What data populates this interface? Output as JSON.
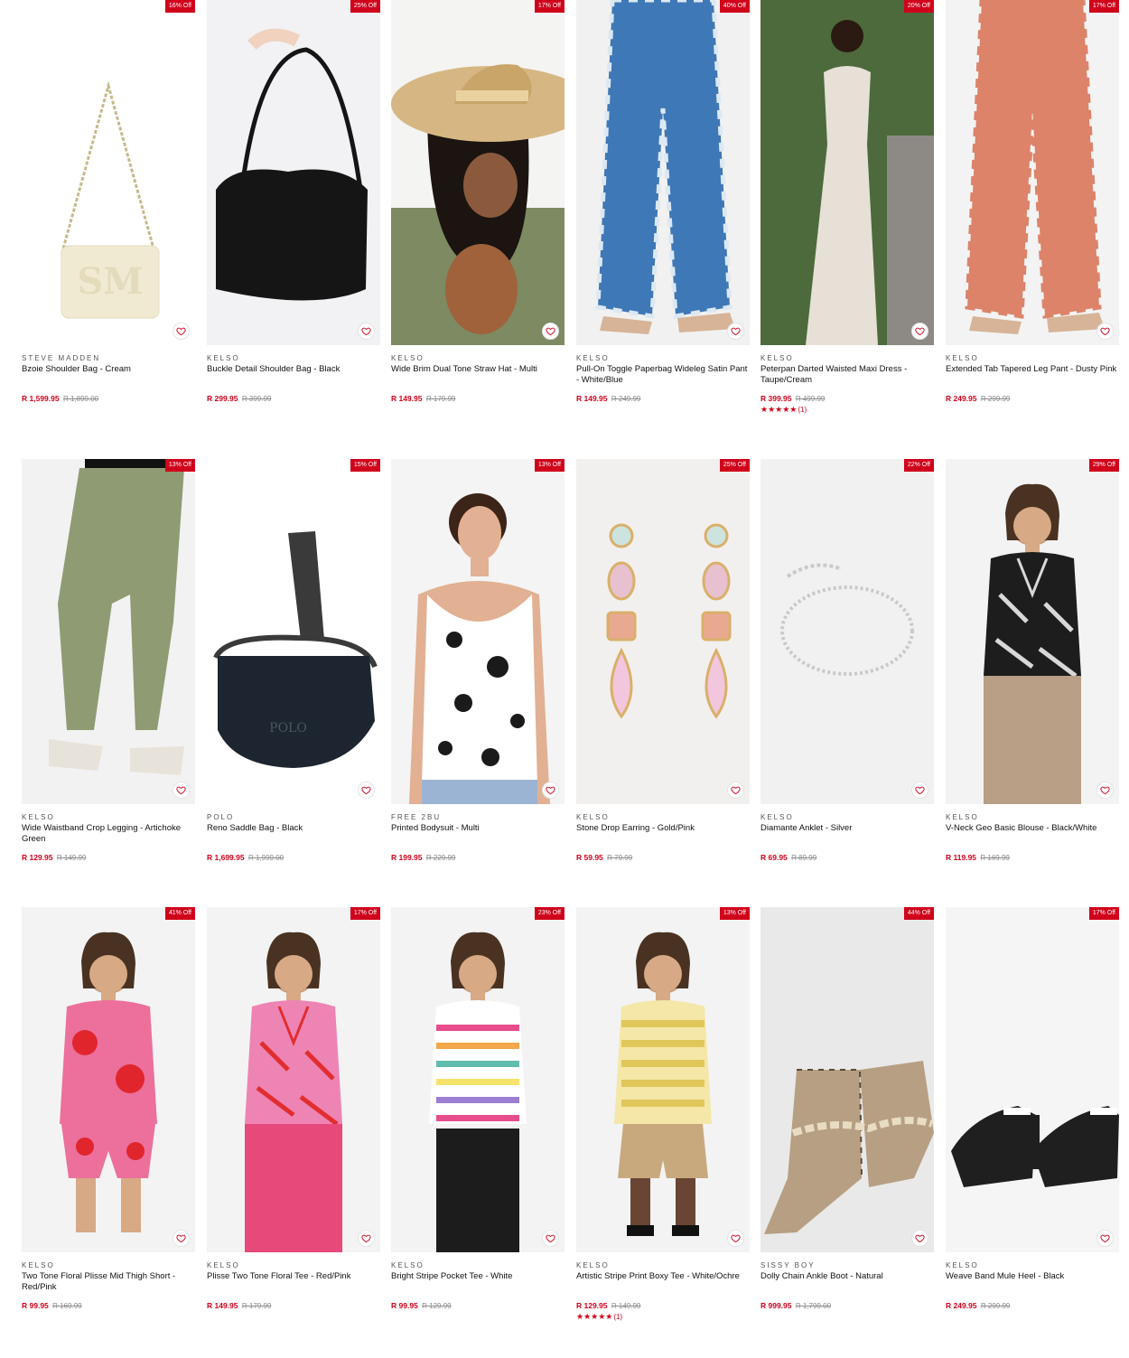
{
  "products": [
    {
      "badge": "16% Off",
      "brand": "STEVE MADDEN",
      "name": "Bzoie Shoulder Bag - Cream",
      "price": "R 1,599.95",
      "was": "R 1,899.00",
      "bg": "#ffffff",
      "kind": "chainbag",
      "c1": "#f1ead3",
      "c2": "#c9b98a",
      "stars": "",
      "reviews": ""
    },
    {
      "badge": "25% Off",
      "brand": "KELSO",
      "name": "Buckle Detail Shoulder Bag - Black",
      "price": "R 299.95",
      "was": "R 399.99",
      "bg": "#f2f2f4",
      "kind": "hobo",
      "c1": "#151515",
      "c2": "#f0d2bf",
      "stars": "",
      "reviews": ""
    },
    {
      "badge": "17% Off",
      "brand": "KELSO",
      "name": "Wide Brim Dual Tone Straw Hat - Multi",
      "price": "R 149.95",
      "was": "R 179.99",
      "bg": "#f4f4f2",
      "kind": "hat",
      "c1": "#d6b783",
      "c2": "#7d8a62",
      "stars": "",
      "reviews": ""
    },
    {
      "badge": "40% Off",
      "brand": "KELSO",
      "name": "Pull-On Toggle Paperbag Wideleg Satin Pant - White/Blue",
      "price": "R 149.95",
      "was": "R 249.99",
      "bg": "#f1f1f1",
      "kind": "pants",
      "c1": "#3e78b7",
      "c2": "#dce8f3",
      "stars": "",
      "reviews": ""
    },
    {
      "badge": "20% Off",
      "brand": "KELSO",
      "name": "Peterpan Darted Waisted Maxi Dress - Taupe/Cream",
      "price": "R 399.95",
      "was": "R 499.99",
      "bg": "#4b5f3a",
      "kind": "maxi",
      "c1": "#e6e0d6",
      "c2": "#3b2a20",
      "stars": "★★★★★",
      "reviews": "(1)"
    },
    {
      "badge": "17% Off",
      "brand": "KELSO",
      "name": "Extended Tab Tapered Leg Pant - Dusty Pink",
      "price": "R 249.95",
      "was": "R 299.99",
      "bg": "#f3f3f3",
      "kind": "pants",
      "c1": "#dc8369",
      "c2": "#dc8369",
      "stars": "",
      "reviews": ""
    },
    {
      "badge": "13% Off",
      "brand": "KELSO",
      "name": "Wide Waistband Crop Legging - Artichoke Green",
      "price": "R 129.95",
      "was": "R 149.99",
      "bg": "#f2f2f2",
      "kind": "legging",
      "c1": "#8f9b73",
      "c2": "#e8e3da",
      "stars": "",
      "reviews": ""
    },
    {
      "badge": "15% Off",
      "brand": "POLO",
      "name": "Reno Saddle Bag - Black",
      "price": "R 1,699.95",
      "was": "R 1,999.00",
      "bg": "#ffffff",
      "kind": "saddle",
      "c1": "#1c2530",
      "c2": "#3a3a3a",
      "stars": "",
      "reviews": ""
    },
    {
      "badge": "13% Off",
      "brand": "FREE 2BU",
      "name": "Printed Bodysuit - Multi",
      "price": "R 199.95",
      "was": "R 229.99",
      "bg": "#f4f4f4",
      "kind": "bodysuit",
      "c1": "#ffffff",
      "c2": "#1a1a1a",
      "stars": "",
      "reviews": ""
    },
    {
      "badge": "25% Off",
      "brand": "KELSO",
      "name": "Stone Drop Earring - Gold/Pink",
      "price": "R 59.95",
      "was": "R 79.99",
      "bg": "#f2f0ee",
      "kind": "earring",
      "c1": "#e9a991",
      "c2": "#d9b06a",
      "stars": "",
      "reviews": ""
    },
    {
      "badge": "22% Off",
      "brand": "KELSO",
      "name": "Diamante Anklet - Silver",
      "price": "R 69.95",
      "was": "R 89.99",
      "bg": "#f1f1f1",
      "kind": "anklet",
      "c1": "#c9c9c9",
      "c2": "#ffffff",
      "stars": "",
      "reviews": ""
    },
    {
      "badge": "29% Off",
      "brand": "KELSO",
      "name": "V-Neck Geo Basic Blouse - Black/White",
      "price": "R 119.95",
      "was": "R 169.99",
      "bg": "#f3f3f3",
      "kind": "top",
      "c1": "#1d1d1d",
      "c2": "#d8d8d8",
      "stars": "",
      "reviews": ""
    },
    {
      "badge": "41% Off",
      "brand": "KELSO",
      "name": "Two Tone Floral Plisse Mid Thigh Short - Red/Pink",
      "price": "R 99.95",
      "was": "R 169.99",
      "bg": "#f3f3f3",
      "kind": "set",
      "c1": "#ec6f9c",
      "c2": "#e0262c",
      "stars": "",
      "reviews": ""
    },
    {
      "badge": "17% Off",
      "brand": "KELSO",
      "name": "Plisse Two Tone Floral Tee - Red/Pink",
      "price": "R 149.95",
      "was": "R 179.99",
      "bg": "#f3f3f3",
      "kind": "top",
      "c1": "#ee84b3",
      "c2": "#e22d2f",
      "stars": "",
      "reviews": ""
    },
    {
      "badge": "23% Off",
      "brand": "KELSO",
      "name": "Bright Stripe Pocket Tee - White",
      "price": "R 99.95",
      "was": "R 129.99",
      "bg": "#f3f3f3",
      "kind": "stripetee",
      "c1": "#ffffff",
      "c2": "#e74c8b",
      "stars": "",
      "reviews": ""
    },
    {
      "badge": "13% Off",
      "brand": "KELSO",
      "name": "Artistic Stripe Print Boxy Tee - White/Ochre",
      "price": "R 129.95",
      "was": "R 149.99",
      "bg": "#f3f3f3",
      "kind": "ochre",
      "c1": "#f4e7a8",
      "c2": "#c8a97e",
      "stars": "★★★★★",
      "reviews": "(1)"
    },
    {
      "badge": "44% Off",
      "brand": "SISSY BOY",
      "name": "Dolly Chain Ankle Boot - Natural",
      "price": "R 999.95",
      "was": "R 1,799.00",
      "bg": "#e9e9e9",
      "kind": "boots",
      "c1": "#b79f83",
      "c2": "#5b4a3b",
      "stars": "",
      "reviews": ""
    },
    {
      "badge": "17% Off",
      "brand": "KELSO",
      "name": "Weave Band Mule Heel - Black",
      "price": "R 249.95",
      "was": "R 299.99",
      "bg": "#f5f5f5",
      "kind": "mules",
      "c1": "#1f1f1f",
      "c2": "#ffffff",
      "stars": "",
      "reviews": ""
    }
  ]
}
